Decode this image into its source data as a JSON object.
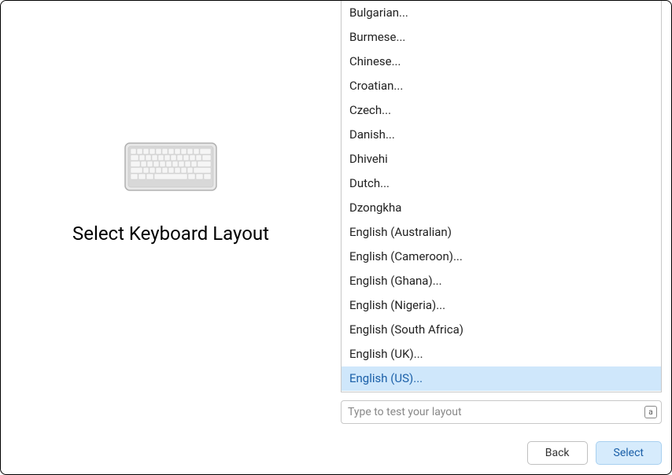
{
  "title": "Select Keyboard Layout",
  "layouts": [
    {
      "label": "Bulgarian...",
      "selected": false
    },
    {
      "label": "Burmese...",
      "selected": false
    },
    {
      "label": "Chinese...",
      "selected": false
    },
    {
      "label": "Croatian...",
      "selected": false
    },
    {
      "label": "Czech...",
      "selected": false
    },
    {
      "label": "Danish...",
      "selected": false
    },
    {
      "label": "Dhivehi",
      "selected": false
    },
    {
      "label": "Dutch...",
      "selected": false
    },
    {
      "label": "Dzongkha",
      "selected": false
    },
    {
      "label": "English (Australian)",
      "selected": false
    },
    {
      "label": "English (Cameroon)...",
      "selected": false
    },
    {
      "label": "English (Ghana)...",
      "selected": false
    },
    {
      "label": "English (Nigeria)...",
      "selected": false
    },
    {
      "label": "English (South Africa)",
      "selected": false
    },
    {
      "label": "English (UK)...",
      "selected": false
    },
    {
      "label": "English (US)...",
      "selected": true
    }
  ],
  "testInput": {
    "placeholder": "Type to test your layout",
    "badge": "a"
  },
  "buttons": {
    "back": "Back",
    "select": "Select"
  }
}
